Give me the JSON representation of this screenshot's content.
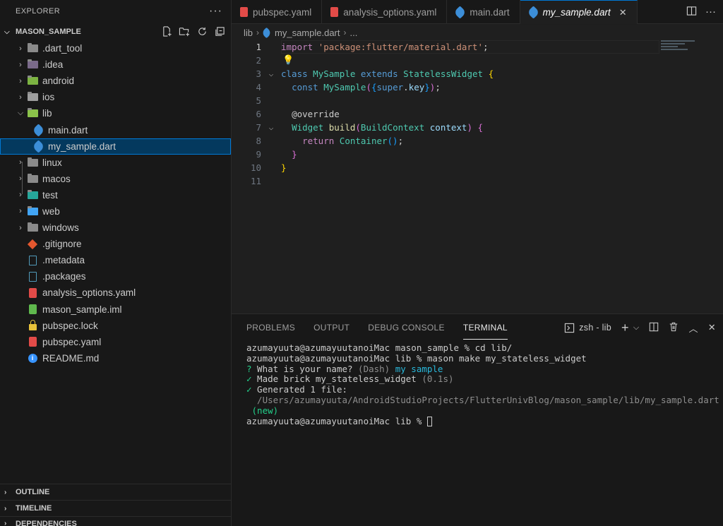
{
  "explorer": {
    "title": "EXPLORER",
    "project": "MASON_SAMPLE",
    "items": [
      {
        "label": ".dart_tool",
        "type": "folder"
      },
      {
        "label": ".idea",
        "type": "folder"
      },
      {
        "label": "android",
        "type": "folder"
      },
      {
        "label": "ios",
        "type": "folder"
      },
      {
        "label": "lib",
        "type": "folder-open"
      },
      {
        "label": "main.dart",
        "type": "dart"
      },
      {
        "label": "my_sample.dart",
        "type": "dart"
      },
      {
        "label": "linux",
        "type": "folder"
      },
      {
        "label": "macos",
        "type": "folder"
      },
      {
        "label": "test",
        "type": "folder"
      },
      {
        "label": "web",
        "type": "folder"
      },
      {
        "label": "windows",
        "type": "folder"
      },
      {
        "label": ".gitignore",
        "type": "git"
      },
      {
        "label": ".metadata",
        "type": "doc"
      },
      {
        "label": ".packages",
        "type": "doc"
      },
      {
        "label": "analysis_options.yaml",
        "type": "yaml"
      },
      {
        "label": "mason_sample.iml",
        "type": "iml"
      },
      {
        "label": "pubspec.lock",
        "type": "lock"
      },
      {
        "label": "pubspec.yaml",
        "type": "yaml"
      },
      {
        "label": "README.md",
        "type": "info"
      }
    ],
    "sections": [
      "OUTLINE",
      "TIMELINE",
      "DEPENDENCIES"
    ]
  },
  "tabs": [
    {
      "label": "pubspec.yaml"
    },
    {
      "label": "analysis_options.yaml"
    },
    {
      "label": "main.dart"
    },
    {
      "label": "my_sample.dart"
    }
  ],
  "breadcrumb": [
    "lib",
    "my_sample.dart",
    "..."
  ],
  "editor": {
    "line_numbers": [
      "1",
      "2",
      "3",
      "4",
      "5",
      "6",
      "7",
      "8",
      "9",
      "10",
      "11"
    ],
    "lines": {
      "l1a": "import",
      "l1b": "'package:flutter/material.dart'",
      "l1c": ";",
      "l3a": "class",
      "l3b": "MySample",
      "l3c": "extends",
      "l3d": "StatelessWidget",
      "l3e": "{",
      "l4a": "const",
      "l4b": "MySample",
      "l4c": "(",
      "l4d": "{",
      "l4e": "super",
      "l4f": ".",
      "l4g": "key",
      "l4h": "}",
      "l4i": ")",
      "l4j": ";",
      "l6a": "@override",
      "l7a": "Widget",
      "l7b": "build",
      "l7c": "(",
      "l7d": "BuildContext",
      "l7e": "context",
      "l7f": ")",
      "l7g": "{",
      "l8a": "return",
      "l8b": "Container",
      "l8c": "()",
      "l8d": ";",
      "l9a": "}",
      "l10a": "}"
    }
  },
  "panel": {
    "tabs": [
      "PROBLEMS",
      "OUTPUT",
      "DEBUG CONSOLE",
      "TERMINAL"
    ],
    "terminal_name": "zsh - lib",
    "terminal": {
      "line1": "azumayuuta@azumayuutanoiMac mason_sample % cd lib/",
      "line2": "azumayuuta@azumayuutanoiMac lib % mason make my_stateless_widget",
      "q_mark": "?",
      "q_text": " What is your name? ",
      "q_hint": "(Dash)",
      "q_answer": " my sample",
      "check1": "✓",
      "made": " Made brick my_stateless_widget ",
      "made_time": "(0.1s)",
      "check2": "✓",
      "generated": " Generated 1 file:",
      "path": "  /Users/azumayuuta/AndroidStudioProjects/FlutterUnivBlog/mason_sample/lib/my_sample.dart",
      "new": " (new)",
      "prompt": "azumayuuta@azumayuutanoiMac lib % "
    }
  }
}
